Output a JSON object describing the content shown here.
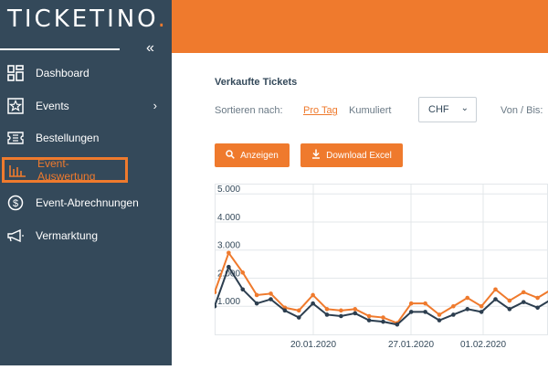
{
  "app": {
    "logo": "TICKETINO",
    "logo_dot": "."
  },
  "sidebar": {
    "collapse_icon": "double-chevron-left-icon",
    "items": [
      {
        "label": "Dashboard",
        "icon": "dashboard-icon"
      },
      {
        "label": "Events",
        "icon": "star-icon",
        "has_submenu": true
      },
      {
        "label": "Bestellungen",
        "icon": "ticket-icon"
      },
      {
        "label": "Event-Auswertung",
        "icon": "bar-chart-icon",
        "active": true
      },
      {
        "label": "Event-Abrechnungen",
        "icon": "dollar-icon"
      },
      {
        "label": "Vermarktung",
        "icon": "megaphone-icon"
      }
    ]
  },
  "main": {
    "title": "Verkaufte Tickets",
    "sort_label": "Sortieren nach:",
    "sort_pro_tag": "Pro Tag",
    "sort_kumuliert": "Kumuliert",
    "currency": "CHF",
    "von_bis": "Von / Bis:",
    "btn_show": "Anzeigen",
    "btn_download": "Download Excel"
  },
  "colors": {
    "accent": "#ef7a2d",
    "sidebar": "#34495a",
    "series_dark": "#2c3e4f"
  },
  "chart_data": {
    "type": "line",
    "y_ticks": [
      "5.000",
      "4.000",
      "3.000",
      "2.000",
      "1.000"
    ],
    "x_ticks": [
      "20.01.2020",
      "27.01.2020",
      "01.02.2020"
    ],
    "ylim": [
      0,
      5300
    ],
    "series": [
      {
        "color": "#ef7a2d",
        "values": [
          1500,
          2900,
          2200,
          1400,
          1450,
          950,
          850,
          1400,
          900,
          850,
          900,
          650,
          600,
          400,
          1100,
          1100,
          700,
          1000,
          1300,
          1000,
          1600,
          1200,
          1500,
          1300,
          1600
        ]
      },
      {
        "color": "#2c3e4f",
        "values": [
          1000,
          2400,
          1600,
          1100,
          1250,
          850,
          600,
          1100,
          700,
          650,
          750,
          500,
          450,
          350,
          800,
          800,
          500,
          700,
          900,
          800,
          1250,
          900,
          1150,
          950,
          1250
        ]
      }
    ]
  }
}
